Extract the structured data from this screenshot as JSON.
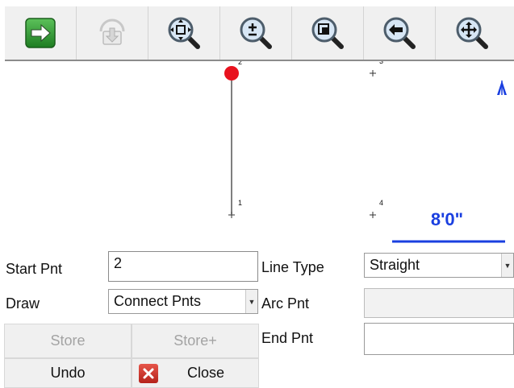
{
  "toolbar": {
    "buttons": [
      {
        "name": "next-arrow-icon"
      },
      {
        "name": "store-point-icon"
      },
      {
        "name": "zoom-extents-icon"
      },
      {
        "name": "zoom-in-out-icon"
      },
      {
        "name": "zoom-window-icon"
      },
      {
        "name": "zoom-previous-icon"
      },
      {
        "name": "pan-icon"
      }
    ]
  },
  "canvas": {
    "points": [
      {
        "label": "1"
      },
      {
        "label": "2"
      },
      {
        "label": "3"
      },
      {
        "label": "4"
      }
    ],
    "scale_label": "8'0\"",
    "north_symbol": "north-arrow-icon",
    "colors": {
      "marker": "#e8121e",
      "scale": "#1a3fe0",
      "line": "#555555"
    }
  },
  "form": {
    "start_pnt_label": "Start Pnt",
    "start_pnt_value": "2",
    "draw_label": "Draw",
    "draw_value": "Connect Pnts",
    "line_type_label": "Line Type",
    "line_type_value": "Straight",
    "arc_pnt_label": "Arc Pnt",
    "arc_pnt_value": "",
    "end_pnt_label": "End Pnt",
    "end_pnt_value": ""
  },
  "buttons": {
    "store": "Store",
    "store_plus": "Store+",
    "undo": "Undo",
    "close": "Close"
  }
}
